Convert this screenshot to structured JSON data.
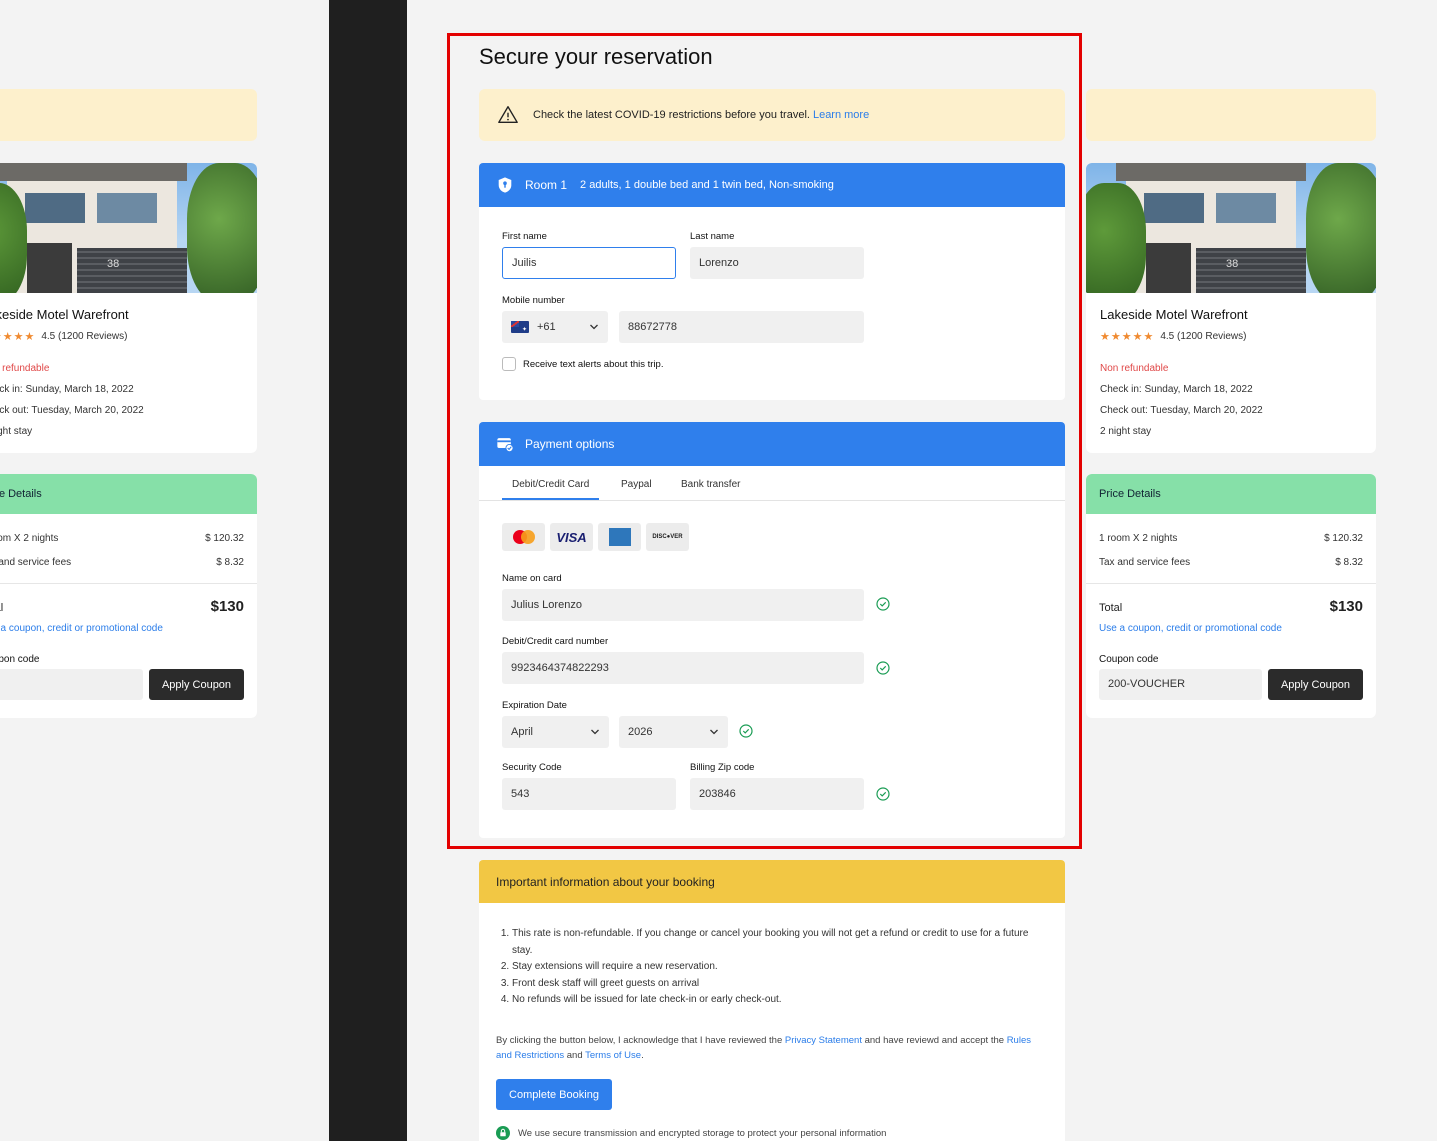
{
  "page": {
    "title": "Secure your reservation"
  },
  "covid": {
    "text": "Check the latest COVID-19 restrictions before you travel.",
    "link": "Learn more"
  },
  "room": {
    "title": "Room 1",
    "details": "2 adults, 1 double bed and 1 twin bed, Non-smoking",
    "first_name_label": "First name",
    "first_name_value": "Juilis",
    "last_name_label": "Last name",
    "last_name_value": "Lorenzo",
    "mobile_label": "Mobile number",
    "country_code": "+61",
    "mobile_value": "88672778",
    "sms_alert_label": "Receive text alerts about this trip."
  },
  "payment": {
    "title": "Payment options",
    "tabs": [
      "Debit/Credit Card",
      "Paypal",
      "Bank transfer"
    ],
    "active_tab": "Debit/Credit Card",
    "card_logos": [
      "mastercard-icon",
      "visa-icon",
      "amex-icon",
      "discover-icon"
    ],
    "visa_text": "VISA",
    "discover_text": "DISC●VER",
    "name_label": "Name on card",
    "name_value": "Julius Lorenzo",
    "number_label": "Debit/Credit card number",
    "number_value": "9923464374822293",
    "expiry_label": "Expiration Date",
    "expiry_month": "April",
    "expiry_year": "2026",
    "security_label": "Security Code",
    "security_value": "543",
    "zip_label": "Billing Zip code",
    "zip_value": "203846"
  },
  "info": {
    "title": "Important information about your booking",
    "items": [
      "This rate is non-refundable. If you change or cancel your booking you will not get a refund or credit to use for a future stay.",
      "Stay extensions will require a new reservation.",
      "Front desk staff will greet guests on arrival",
      "No refunds will be issued for late check-in or early check-out."
    ],
    "ack_prefix": "By clicking the button below, I acknowledge that I have reviewed the",
    "privacy_link": "Privacy Statement",
    "ack_middle": "and have reviewd and accept the",
    "rules_link": "Rules and Restrictions",
    "ack_and": "and",
    "terms_link": "Terms of Use",
    "ack_end": ".",
    "complete_button": "Complete Booking",
    "secure_note": "We use secure transmission and encrypted storage to protect your personal information"
  },
  "hotel": {
    "name": "Lakeside Motel Warefront",
    "stars": "★★★★★",
    "rating_text": "4.5 (1200 Reviews)",
    "refund": "Non refundable",
    "check_in": "Check in: Sunday, March 18, 2022",
    "check_out": "Check out: Tuesday, March 20, 2022",
    "stay": "2 night stay",
    "photo_number": "38"
  },
  "price": {
    "title": "Price Details",
    "room_label": "1 room X 2 nights",
    "room_value": "$ 120.32",
    "tax_label": "Tax and service fees",
    "tax_value": "$ 8.32",
    "total_label": "Total",
    "total_value": "$130",
    "coupon_link": "Use a coupon, credit or promotional code",
    "coupon_label": "Coupon code",
    "coupon_value": "200-VOUCHER",
    "apply_button": "Apply Coupon"
  },
  "colors": {
    "primary": "#2f7fec",
    "alert_bg": "#fdf0cc",
    "price_header": "#86e0a8",
    "info_header": "#f2c744",
    "danger": "#e04848",
    "highlight_frame": "#e30000"
  }
}
